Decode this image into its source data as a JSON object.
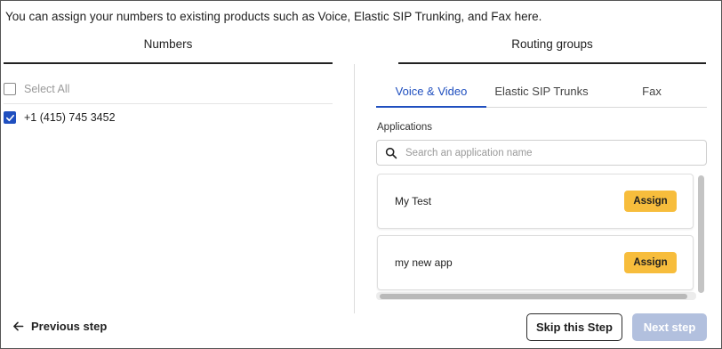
{
  "intro_text": "You can assign your numbers to existing products such as Voice, Elastic SIP Trunking, and Fax here.",
  "numbers_panel": {
    "heading": "Numbers",
    "select_all_label": "Select All",
    "numbers": [
      {
        "label": "+1 (415) 745 3452",
        "checked": true
      }
    ]
  },
  "routing_panel": {
    "heading": "Routing groups",
    "tabs": [
      {
        "label": "Voice & Video",
        "active": true
      },
      {
        "label": "Elastic SIP Trunks",
        "active": false
      },
      {
        "label": "Fax",
        "active": false
      }
    ],
    "applications_label": "Applications",
    "search_placeholder": "Search an application name",
    "applications": [
      {
        "name": "My Test",
        "action_label": "Assign"
      },
      {
        "name": "my new app",
        "action_label": "Assign"
      }
    ]
  },
  "footer": {
    "previous_label": "Previous step",
    "skip_label": "Skip this Step",
    "next_label": "Next step"
  },
  "colors": {
    "accent": "#1f4fbf",
    "assign_button": "#f7bd3c",
    "next_disabled": "#b2c0de"
  },
  "icons": {
    "search": "search-icon",
    "back": "arrow-left-icon",
    "check": "checkmark-icon"
  }
}
